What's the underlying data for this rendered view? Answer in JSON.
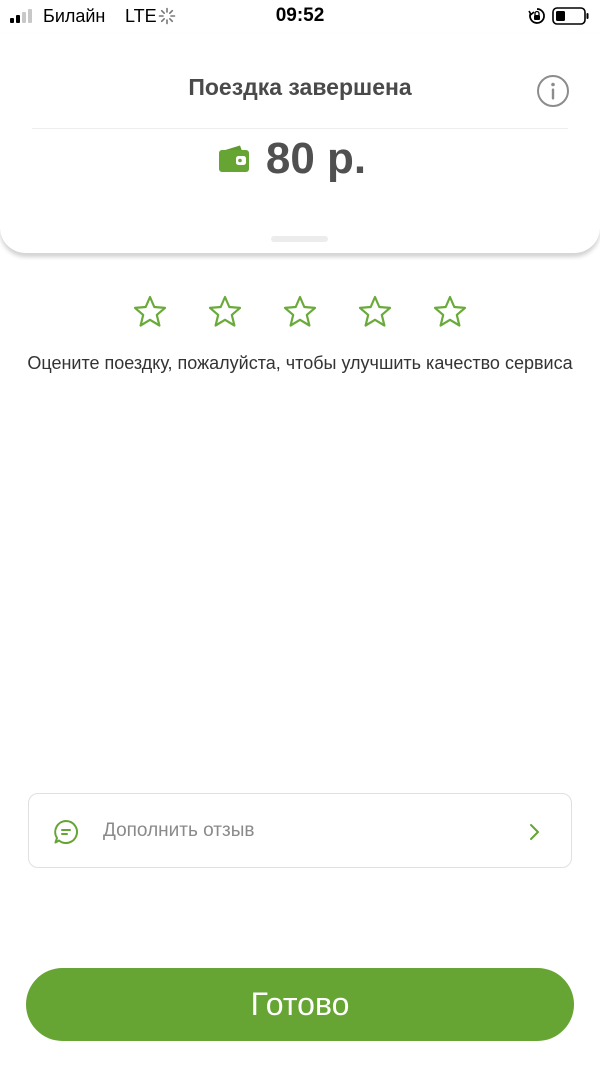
{
  "status_bar": {
    "carrier": "Билайн",
    "network": "LTE",
    "time": "09:52"
  },
  "trip": {
    "title": "Поездка завершена",
    "price": "80 р."
  },
  "rating": {
    "stars_total": 5,
    "stars_selected": 0,
    "prompt": "Оцените поездку, пожалуйста, чтобы улучшить качество сервиса"
  },
  "review": {
    "label": "Дополнить отзыв"
  },
  "actions": {
    "done_label": "Готово"
  },
  "colors": {
    "accent": "#66a434",
    "star_outline": "#6aaa3a",
    "title_text": "#4a4a4a"
  },
  "icons": {
    "info": "info-icon",
    "wallet": "wallet-icon",
    "star": "star-outline-icon",
    "comment": "comment-icon",
    "chevron": "chevron-right-icon"
  }
}
